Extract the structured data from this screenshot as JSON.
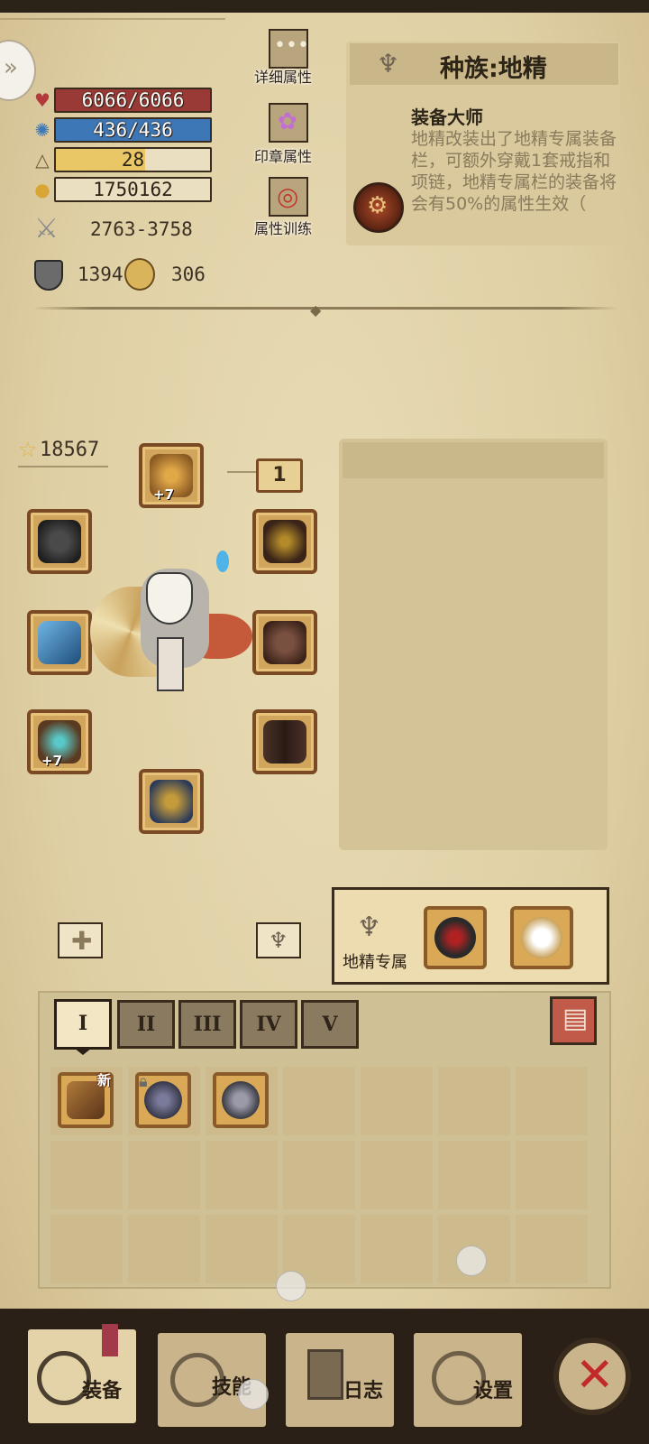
{
  "stats": {
    "hp": "6066/6066",
    "mp": "436/436",
    "level": "28",
    "level_progress": 0.58,
    "gold": "1750162",
    "attack": "2763-3758",
    "defense": "1394",
    "resist": "306"
  },
  "side_buttons": {
    "details": "详细属性",
    "seal": "印章属性",
    "training": "属性训练"
  },
  "race": {
    "title": "种族:地精",
    "skill_name": "装备大师",
    "description": "地精改装出了地精专属装备栏，可额外穿戴1套戒指和项链，地精专属栏的装备将会有50%的属性生效（"
  },
  "equipment": {
    "power": "18567",
    "level_box": "1",
    "helmet_plus": "+7",
    "bracer_plus": "+7"
  },
  "gnome_exclusive": {
    "label": "地精专属"
  },
  "inventory": {
    "tabs": [
      "I",
      "II",
      "III",
      "IV",
      "V"
    ],
    "new_badge": "新"
  },
  "nav": {
    "equip": "装备",
    "skills": "技能",
    "log": "日志",
    "settings": "设置"
  },
  "colors": {
    "hp": "#9a3a36",
    "mp": "#3d77b5",
    "xp": "#e9c766",
    "close": "#c22a2a"
  }
}
